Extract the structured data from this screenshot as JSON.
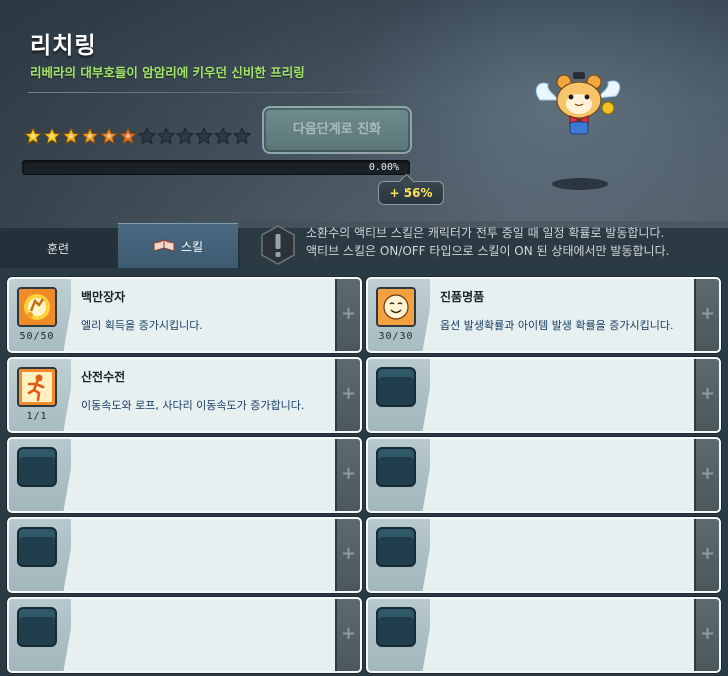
{
  "header": {
    "title": "리치링",
    "subtitle": "리베라의 대부호들이 암암리에 키우던 신비한 프리링",
    "star_count": 12,
    "stars_filled": 6,
    "star_colors": [
      "#f2c91c",
      "#f2c91c",
      "#f0b421",
      "#ee9e2a",
      "#ec8a30",
      "#e6722e"
    ],
    "progress_value": 0,
    "progress_text": "0.00%",
    "bonus_text": "+ 56%",
    "advance_button_label": "다음단계로 진화"
  },
  "tabs": {
    "training_label": "훈련",
    "skill_label": "스킬",
    "active": "skill"
  },
  "notice": {
    "line1": "소환수의 액티브 스킬은 캐릭터가 전투 중일 때 일정 확률로 발동합니다.",
    "line2": "액티브 스킬은 ON/OFF 타입으로 스킬이 ON 된 상태에서만 발동합니다."
  },
  "skills": [
    {
      "name": "백만장자",
      "desc": "엘리 획득을 증가시킵니다.",
      "level": "50/50",
      "icon": "coin-bag-icon"
    },
    {
      "name": "진품명품",
      "desc": "옵션 발생확률과 아이템 발생 확률을 증가시킵니다.",
      "level": "30/30",
      "icon": "appraiser-face-icon"
    },
    {
      "name": "산전수전",
      "desc": "이동속도와 로프, 사다리 이동속도가 증가합니다.",
      "level": "1/1",
      "icon": "running-man-icon"
    }
  ],
  "plus_label": "+"
}
